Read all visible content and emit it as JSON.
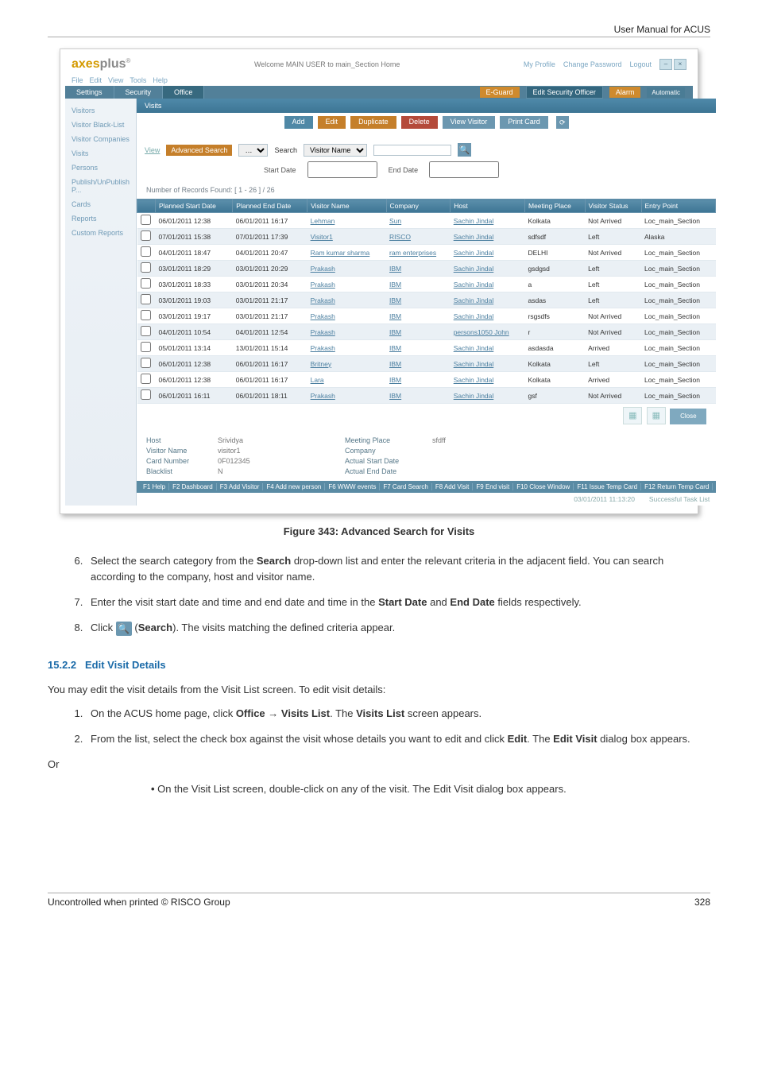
{
  "doc": {
    "header": "User Manual for ACUS",
    "figure_caption": "Figure 343: Advanced Search for Visits",
    "step6": "Select the search category from the ",
    "step6b": "Search",
    "step6c": " drop-down list and enter the relevant criteria in the adjacent field. You can search according to the company, host and visitor name.",
    "step7a": "Enter the visit start date and time and end date and time in the ",
    "step7b": "Start Date",
    "step7c": " and ",
    "step7d": "End Date",
    "step7e": " fields respectively.",
    "step8a": "Click ",
    "step8b": " (",
    "step8c": "Search",
    "step8d": "). The visits matching the defined criteria appear.",
    "sect_num": "15.2.2",
    "sect_title": "Edit Visit Details",
    "edit_intro": "You may edit the visit details from the Visit List screen. To edit visit details:",
    "edit_step1a": "On the ACUS home page, click ",
    "edit_step1b": "Office",
    "edit_step1arrow": " → ",
    "edit_step1c": "Visits List",
    "edit_step1d": ". The ",
    "edit_step1e": "Visits List",
    "edit_step1f": " screen appears.",
    "edit_step2a": "From the list, select the check box against the visit whose details you want to edit and click ",
    "edit_step2b": "Edit",
    "edit_step2c": ". The ",
    "edit_step2d": "Edit Visit",
    "edit_step2e": " dialog box appears.",
    "or": "Or",
    "bullet": "On the Visit List screen, double-click on any of the visit. The Edit Visit dialog box appears.",
    "footer_left": "Uncontrolled when printed © RISCO Group",
    "footer_right": "328"
  },
  "app": {
    "logo_a": "axes",
    "logo_b": "plus",
    "trade": "®",
    "welcome": "Welcome MAIN USER  to main_Section  Home",
    "links": {
      "profile": "My Profile",
      "changepw": "Change Password",
      "logout": "Logout"
    },
    "menu": [
      "File",
      "Edit",
      "View",
      "Tools",
      "Help"
    ],
    "ribbon": {
      "t1": "Settings",
      "t2": "Security",
      "t3": "Office",
      "p1": "E-Guard",
      "p2": "Edit Security Officer",
      "p3": "Alarm",
      "mode": "Automatic"
    },
    "side": [
      "Visitors",
      "Visitor Black-List",
      "Visitor Companies",
      "Visits",
      "Persons",
      "Publish/UnPublish P...",
      "Cards",
      "Reports",
      "Custom Reports"
    ],
    "panel": "Visits",
    "view": "View",
    "adv": "Advanced Search",
    "searchlbl": "Search",
    "search_sel": "Visitor Name",
    "actions": {
      "add": "Add",
      "edit": "Edit",
      "dup": "Duplicate",
      "del": "Delete",
      "vis": "View Visitor",
      "card": "Print Card"
    },
    "startdate": "Start Date",
    "enddate": "End Date",
    "count": "Number of Records Found: [ 1 - 26 ] / 26",
    "cols": [
      "",
      "Planned Start Date",
      "Planned End Date",
      "Visitor Name",
      "Company",
      "Host",
      "Meeting Place",
      "Visitor Status",
      "Entry Point"
    ],
    "rows": [
      [
        "06/01/2011 12:38",
        "06/01/2011 16:17",
        "Lehman",
        "Sun",
        "Sachin Jindal",
        "Kolkata",
        "Not Arrived",
        "Loc_main_Section"
      ],
      [
        "07/01/2011 15:38",
        "07/01/2011 17:39",
        "Visitor1",
        "RISCO",
        "Sachin Jindal",
        "sdfsdf",
        "Left",
        "Alaska"
      ],
      [
        "04/01/2011 18:47",
        "04/01/2011 20:47",
        "Ram kumar sharma",
        "ram enterprises",
        "Sachin Jindal",
        "DELHI",
        "Not Arrived",
        "Loc_main_Section"
      ],
      [
        "03/01/2011 18:29",
        "03/01/2011 20:29",
        "Prakash",
        "IBM",
        "Sachin Jindal",
        "gsdgsd",
        "Left",
        "Loc_main_Section"
      ],
      [
        "03/01/2011 18:33",
        "03/01/2011 20:34",
        "Prakash",
        "IBM",
        "Sachin Jindal",
        "a",
        "Left",
        "Loc_main_Section"
      ],
      [
        "03/01/2011 19:03",
        "03/01/2011 21:17",
        "Prakash",
        "IBM",
        "Sachin Jindal",
        "asdas",
        "Left",
        "Loc_main_Section"
      ],
      [
        "03/01/2011 19:17",
        "03/01/2011 21:17",
        "Prakash",
        "IBM",
        "Sachin Jindal",
        "rsgsdfs",
        "Not Arrived",
        "Loc_main_Section"
      ],
      [
        "04/01/2011 10:54",
        "04/01/2011 12:54",
        "Prakash",
        "IBM",
        "persons1050 John",
        "r",
        "Not Arrived",
        "Loc_main_Section"
      ],
      [
        "05/01/2011 13:14",
        "13/01/2011 15:14",
        "Prakash",
        "IBM",
        "Sachin Jindal",
        "asdasda",
        "Arrived",
        "Loc_main_Section"
      ],
      [
        "06/01/2011 12:38",
        "06/01/2011 16:17",
        "Britney",
        "IBM",
        "Sachin Jindal",
        "Kolkata",
        "Left",
        "Loc_main_Section"
      ],
      [
        "06/01/2011 12:38",
        "06/01/2011 16:17",
        "Lara",
        "IBM",
        "Sachin Jindal",
        "Kolkata",
        "Arrived",
        "Loc_main_Section"
      ],
      [
        "06/01/2011 16:11",
        "06/01/2011 18:11",
        "Prakash",
        "IBM",
        "Sachin Jindal",
        "gsf",
        "Not Arrived",
        "Loc_main_Section"
      ]
    ],
    "detail": {
      "host_k": "Host",
      "host_v": "Srividya",
      "vn_k": "Visitor Name",
      "vn_v": "visitor1",
      "cn_k": "Card Number",
      "cn_v": "0F012345",
      "bl_k": "Blacklist",
      "bl_v": "N",
      "mp_k": "Meeting Place",
      "mp_v": "sfdff",
      "co_k": "Company",
      "asd_k": "Actual Start Date",
      "aed_k": "Actual End Date"
    },
    "close": "Close",
    "fkeys": [
      "F1 Help",
      "F2 Dashboard",
      "F3 Add Visitor",
      "F4 Add new person",
      "F6 WWW events",
      "F7 Card Search",
      "F8 Add Visit",
      "F9 End visit",
      "F10 Close Window",
      "F11 Issue Temp Card",
      "F12 Return Temp Card"
    ],
    "statustime": "03/01/2011 11:13:20",
    "statusmsg": "Successful   Task List"
  }
}
